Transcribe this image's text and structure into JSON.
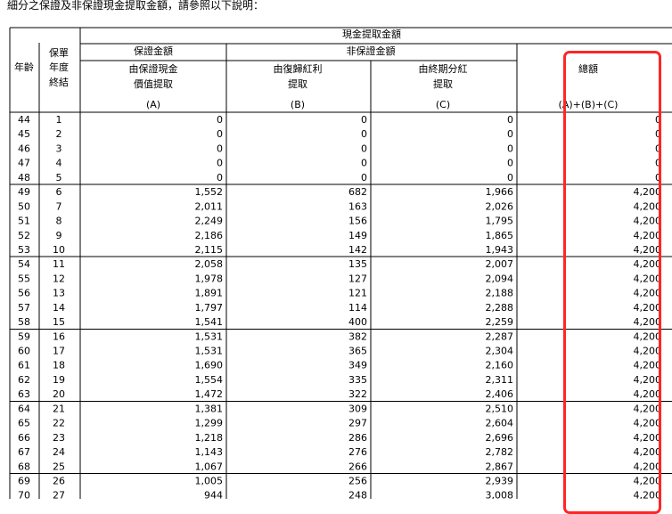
{
  "intro": "細分之保證及非保證現金提取金額，請參照以下說明：",
  "header": {
    "age": "年齡",
    "policy_year_1": "保單",
    "policy_year_2": "年度",
    "policy_year_3": "終結",
    "cash_withdrawal": "現金提取金額",
    "guaranteed": "保證金額",
    "non_guaranteed": "非保證金額",
    "col_a_1": "由保證現金",
    "col_a_2": "價值提取",
    "col_a_code": "(A)",
    "col_b_1": "由復歸紅利",
    "col_b_2": "提取",
    "col_b_code": "(B)",
    "col_c_1": "由終期分紅",
    "col_c_2": "提取",
    "col_c_code": "(C)",
    "total": "總額",
    "total_code": "(A)+(B)+(C)"
  },
  "rows": [
    {
      "age": "44",
      "year": "1",
      "a": "0",
      "b": "0",
      "c": "0",
      "total": "0"
    },
    {
      "age": "45",
      "year": "2",
      "a": "0",
      "b": "0",
      "c": "0",
      "total": "0"
    },
    {
      "age": "46",
      "year": "3",
      "a": "0",
      "b": "0",
      "c": "0",
      "total": "0"
    },
    {
      "age": "47",
      "year": "4",
      "a": "0",
      "b": "0",
      "c": "0",
      "total": "0"
    },
    {
      "age": "48",
      "year": "5",
      "a": "0",
      "b": "0",
      "c": "0",
      "total": "0"
    },
    {
      "age": "49",
      "year": "6",
      "a": "1,552",
      "b": "682",
      "c": "1,966",
      "total": "4,200"
    },
    {
      "age": "50",
      "year": "7",
      "a": "2,011",
      "b": "163",
      "c": "2,026",
      "total": "4,200"
    },
    {
      "age": "51",
      "year": "8",
      "a": "2,249",
      "b": "156",
      "c": "1,795",
      "total": "4,200"
    },
    {
      "age": "52",
      "year": "9",
      "a": "2,186",
      "b": "149",
      "c": "1,865",
      "total": "4,200"
    },
    {
      "age": "53",
      "year": "10",
      "a": "2,115",
      "b": "142",
      "c": "1,943",
      "total": "4,200"
    },
    {
      "age": "54",
      "year": "11",
      "a": "2,058",
      "b": "135",
      "c": "2,007",
      "total": "4,200"
    },
    {
      "age": "55",
      "year": "12",
      "a": "1,978",
      "b": "127",
      "c": "2,094",
      "total": "4,200"
    },
    {
      "age": "56",
      "year": "13",
      "a": "1,891",
      "b": "121",
      "c": "2,188",
      "total": "4,200"
    },
    {
      "age": "57",
      "year": "14",
      "a": "1,797",
      "b": "114",
      "c": "2,288",
      "total": "4,200"
    },
    {
      "age": "58",
      "year": "15",
      "a": "1,541",
      "b": "400",
      "c": "2,259",
      "total": "4,200"
    },
    {
      "age": "59",
      "year": "16",
      "a": "1,531",
      "b": "382",
      "c": "2,287",
      "total": "4,200"
    },
    {
      "age": "60",
      "year": "17",
      "a": "1,531",
      "b": "365",
      "c": "2,304",
      "total": "4,200"
    },
    {
      "age": "61",
      "year": "18",
      "a": "1,690",
      "b": "349",
      "c": "2,160",
      "total": "4,200"
    },
    {
      "age": "62",
      "year": "19",
      "a": "1,554",
      "b": "335",
      "c": "2,311",
      "total": "4,200"
    },
    {
      "age": "63",
      "year": "20",
      "a": "1,472",
      "b": "322",
      "c": "2,406",
      "total": "4,200"
    },
    {
      "age": "64",
      "year": "21",
      "a": "1,381",
      "b": "309",
      "c": "2,510",
      "total": "4,200"
    },
    {
      "age": "65",
      "year": "22",
      "a": "1,299",
      "b": "297",
      "c": "2,604",
      "total": "4,200"
    },
    {
      "age": "66",
      "year": "23",
      "a": "1,218",
      "b": "286",
      "c": "2,696",
      "total": "4,200"
    },
    {
      "age": "67",
      "year": "24",
      "a": "1,143",
      "b": "276",
      "c": "2,782",
      "total": "4,200"
    },
    {
      "age": "68",
      "year": "25",
      "a": "1,067",
      "b": "266",
      "c": "2,867",
      "total": "4,200"
    },
    {
      "age": "69",
      "year": "26",
      "a": "1,005",
      "b": "256",
      "c": "2,939",
      "total": "4,200"
    },
    {
      "age": "70",
      "year": "27",
      "a": "944",
      "b": "248",
      "c": "3,008",
      "total": "4,200"
    }
  ],
  "highlight_color": "#ff2626"
}
